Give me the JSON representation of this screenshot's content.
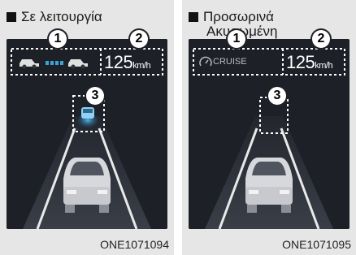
{
  "left": {
    "heading": "Σε λειτουργία",
    "speed": "125",
    "unit": "km/h",
    "code": "ONE1071094",
    "markers": [
      "1",
      "2",
      "3"
    ]
  },
  "right": {
    "heading_line1": "Προσωρινά",
    "heading_line2": "Ακυρωμένη",
    "cruise_label": "CRUISE",
    "speed": "125",
    "unit": "km/h",
    "code": "ONE1071095",
    "markers": [
      "1",
      "2",
      "3"
    ]
  },
  "colors": {
    "screen": "#1e2027",
    "accent_blue": "#3aa3d8",
    "frame": "#e6e6e6"
  },
  "icons": [
    "car-side-icon",
    "cruise-gauge-icon",
    "car-rear-icon"
  ]
}
